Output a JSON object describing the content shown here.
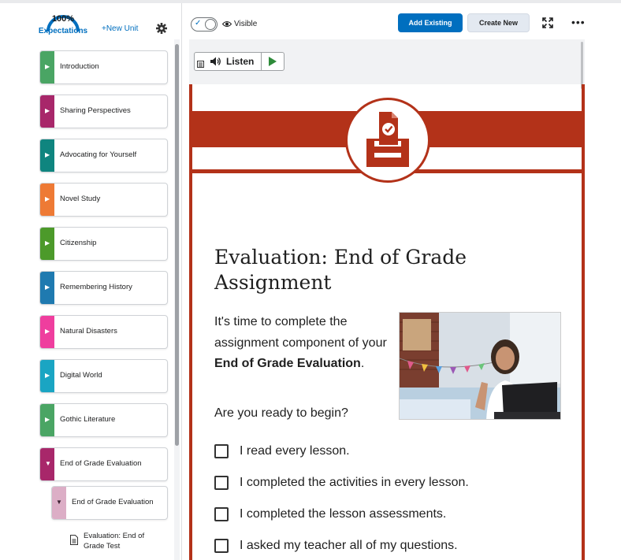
{
  "sidebar": {
    "gauge_pct": "100%",
    "gauge_label": "Expectations",
    "new_unit": "+New Unit",
    "units": [
      {
        "label": "Introduction",
        "color": "#4aa564"
      },
      {
        "label": "Sharing Perspectives",
        "color": "#a8276a"
      },
      {
        "label": "Advocating for Yourself",
        "color": "#0f857f"
      },
      {
        "label": "Novel Study",
        "color": "#ee7a35"
      },
      {
        "label": "Citizenship",
        "color": "#4c9a2a"
      },
      {
        "label": "Remembering History",
        "color": "#1f7ab0"
      },
      {
        "label": "Natural Disasters",
        "color": "#ef3e9e"
      },
      {
        "label": "Digital World",
        "color": "#1aa5c3"
      },
      {
        "label": "Gothic Literature",
        "color": "#4aa564"
      },
      {
        "label": "End of Grade Evaluation",
        "color": "#a8276a"
      }
    ],
    "subunit": "End of Grade Evaluation",
    "topic": "Evaluation: End of Grade Test"
  },
  "toolbar": {
    "visibility": "Visible",
    "add_existing": "Add Existing",
    "create_new": "Create New",
    "more": "•••"
  },
  "reader": {
    "listen": "Listen"
  },
  "content": {
    "title": "Evaluation: End of Grade Assignment",
    "intro_lead": "It's time to complete the assignment component of your ",
    "intro_bold": "End of Grade Evaluation",
    "intro_end": ".",
    "question": "Are you ready to begin?",
    "checklist": [
      "I read every lesson.",
      "I completed the activities in every lesson.",
      "I completed the lesson assessments.",
      "I asked my teacher all of my questions."
    ],
    "accent_color": "#b33219"
  }
}
